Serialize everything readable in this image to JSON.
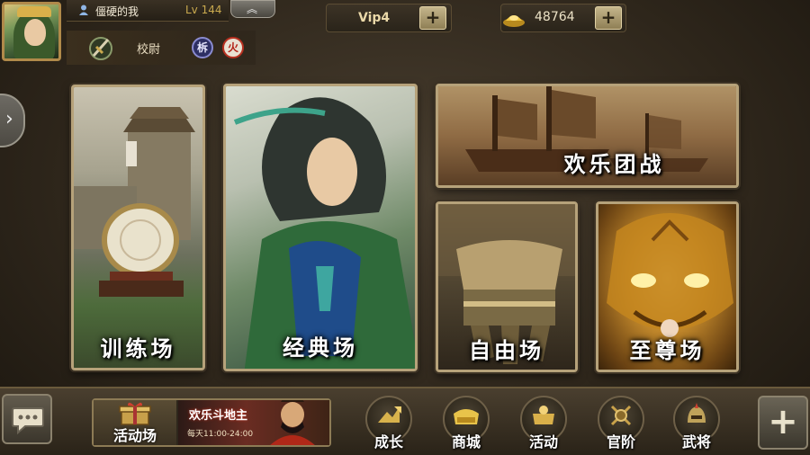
{
  "player": {
    "name": "僵硬的我",
    "level": "Lv 144",
    "rank": "校尉",
    "badges": [
      "柝",
      "火"
    ]
  },
  "header": {
    "vip_label": "Vip4",
    "gold_amount": "48764",
    "collapse_icon": "chevron-up-icon"
  },
  "modes": [
    {
      "label": "训练场"
    },
    {
      "label": "经典场"
    },
    {
      "label": "欢乐团战"
    },
    {
      "label": "自由场"
    },
    {
      "label": "至尊场"
    }
  ],
  "bottom": {
    "event_label": "活动场",
    "banner_title": "欢乐斗地主",
    "banner_time": "每天11:00-24:00",
    "nav": [
      {
        "label": "成长",
        "icon": "growth-icon"
      },
      {
        "label": "商城",
        "icon": "shop-icon"
      },
      {
        "label": "活动",
        "icon": "activity-icon"
      },
      {
        "label": "官阶",
        "icon": "rank-icon"
      },
      {
        "label": "武将",
        "icon": "general-icon"
      }
    ]
  },
  "colors": {
    "frame_gold": "#b6a27a",
    "badge_wood": "#2d2f63",
    "badge_fire": "#b83020"
  }
}
